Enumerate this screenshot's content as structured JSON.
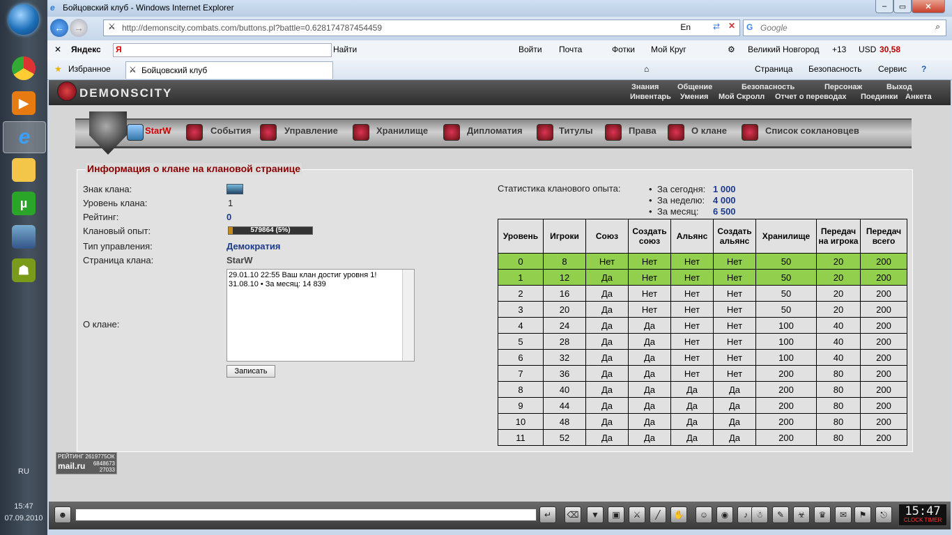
{
  "taskbar": {
    "lang": "RU",
    "time": "15:47",
    "date": "07.09.2010"
  },
  "window": {
    "title": "Бойцовский клуб - Windows Internet Explorer",
    "url": "http://demonscity.combats.com/buttons.pl?battle=0.628174787454459",
    "search_placeholder": "Google",
    "lang_badge": "En"
  },
  "yandex": {
    "brand": "Яндекс",
    "find": "Найти",
    "items": [
      "Войти",
      "Почта",
      "Фотки",
      "Мой Круг"
    ],
    "city": "Великий Новгород",
    "temp": "+13",
    "usd_label": "USD",
    "usd_value": "30,58"
  },
  "favbar": {
    "favorites": "Избранное",
    "tab": "Бойцовский клуб",
    "menu": [
      "Страница",
      "Безопасность",
      "Сервис"
    ]
  },
  "game": {
    "logo": "DEMONSCITY",
    "top_links1": [
      "Знания",
      "Общение",
      "Безопасность",
      "Персонаж",
      "Выход"
    ],
    "top_links2": [
      "Инвентарь",
      "Умения",
      "Мой Скролл",
      "Отчет о переводах",
      "Поединки",
      "Анкета"
    ],
    "nav": [
      "StarW",
      "События",
      "Управление",
      "Хранилище",
      "Дипломатия",
      "Титулы",
      "Права",
      "О клане",
      "Список соклановцев"
    ],
    "panel_title": "Информация о клане на клановой странице",
    "labels": {
      "sign": "Знак клана:",
      "level": "Уровень клана:",
      "rating": "Рейтинг:",
      "exp": "Клановый опыт:",
      "gov": "Тип управления:",
      "page": "Страница клана:",
      "about": "О клане:"
    },
    "values": {
      "level": "1",
      "rating": "0",
      "exp_text": "579864 (5%)",
      "exp_pct": 5,
      "gov": "Демократия",
      "page": "StarW"
    },
    "about_lines": [
      "29.01.10 22:55 Ваш клан достиг уровня 1!",
      "31.08.10 • За месяц: 14 839"
    ],
    "save": "Записать",
    "stats": {
      "title": "Статистика кланового опыта:",
      "today_l": "За сегодня:",
      "today": "1 000",
      "week_l": "За неделю:",
      "week": "4 000",
      "month_l": "За месяц:",
      "month": "6 500"
    },
    "table": {
      "headers": [
        "Уровень",
        "Игроки",
        "Союз",
        "Создать союз",
        "Альянс",
        "Создать альянс",
        "Хранилище",
        "Передач на игрока",
        "Передач всего"
      ],
      "rows": [
        [
          "0",
          "8",
          "Нет",
          "Нет",
          "Нет",
          "Нет",
          "50",
          "20",
          "200"
        ],
        [
          "1",
          "12",
          "Да",
          "Нет",
          "Нет",
          "Нет",
          "50",
          "20",
          "200"
        ],
        [
          "2",
          "16",
          "Да",
          "Нет",
          "Нет",
          "Нет",
          "50",
          "20",
          "200"
        ],
        [
          "3",
          "20",
          "Да",
          "Нет",
          "Нет",
          "Нет",
          "50",
          "20",
          "200"
        ],
        [
          "4",
          "24",
          "Да",
          "Да",
          "Нет",
          "Нет",
          "100",
          "40",
          "200"
        ],
        [
          "5",
          "28",
          "Да",
          "Да",
          "Нет",
          "Нет",
          "100",
          "40",
          "200"
        ],
        [
          "6",
          "32",
          "Да",
          "Да",
          "Нет",
          "Нет",
          "100",
          "40",
          "200"
        ],
        [
          "7",
          "36",
          "Да",
          "Да",
          "Нет",
          "Нет",
          "200",
          "80",
          "200"
        ],
        [
          "8",
          "40",
          "Да",
          "Да",
          "Да",
          "Да",
          "200",
          "80",
          "200"
        ],
        [
          "9",
          "44",
          "Да",
          "Да",
          "Да",
          "Да",
          "200",
          "80",
          "200"
        ],
        [
          "10",
          "48",
          "Да",
          "Да",
          "Да",
          "Да",
          "200",
          "80",
          "200"
        ],
        [
          "11",
          "52",
          "Да",
          "Да",
          "Да",
          "Да",
          "200",
          "80",
          "200"
        ]
      ],
      "highlight_rows": [
        0,
        1
      ],
      "highlight_color": "#92cf4c"
    },
    "counter": {
      "l1": "РЕЙТИНГ 2619775ОК",
      "l2": "mail.ru",
      "n1": "6848673",
      "n2": "27033"
    },
    "clock": "15:47",
    "clock_sub": "CLOCK TIMER"
  }
}
